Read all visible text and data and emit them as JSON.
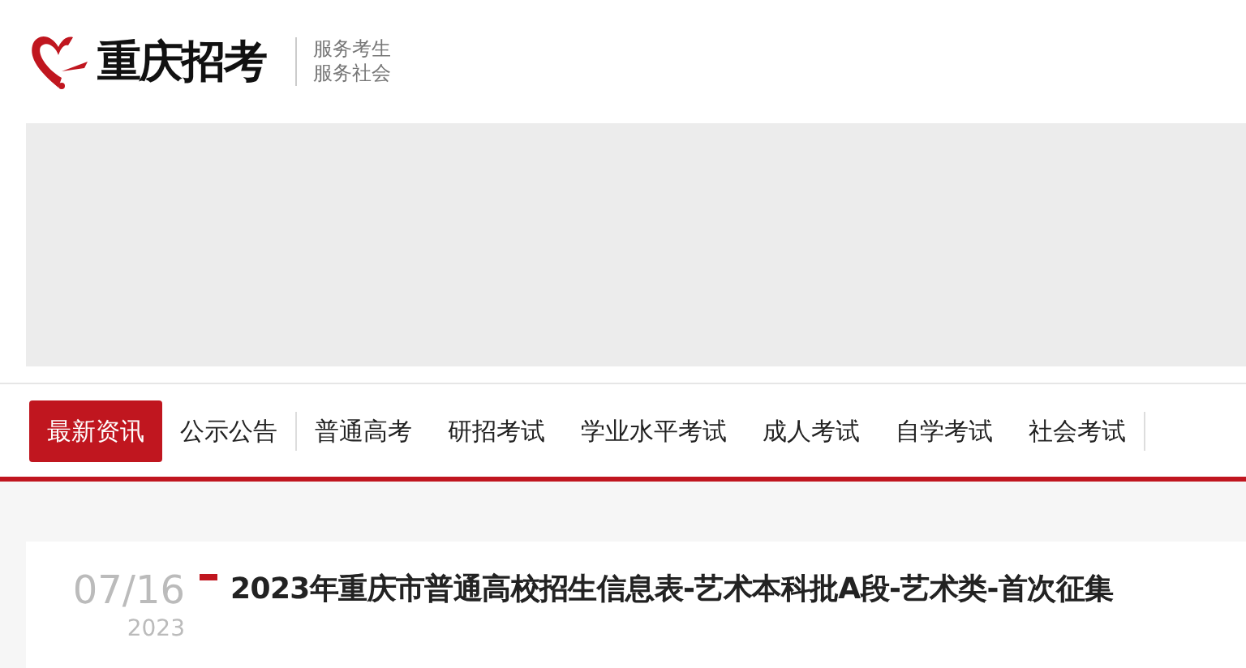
{
  "header": {
    "logo_text": "重庆招考",
    "slogans": [
      "服务考生",
      "服务社会"
    ]
  },
  "banner": {
    "kind": "blank"
  },
  "nav": [
    {
      "label": "最新资讯",
      "selected": true
    },
    {
      "label": "公示公告",
      "selected": false
    },
    {
      "label": "普通高考",
      "selected": false
    },
    {
      "label": "研招考试",
      "selected": false
    },
    {
      "label": "学业水平考试",
      "selected": false
    },
    {
      "label": "成人考试",
      "selected": false
    },
    {
      "label": "自学考试",
      "selected": false
    },
    {
      "label": "社会考试",
      "selected": false
    }
  ],
  "articles": [
    {
      "date": "07/16",
      "year": "2023",
      "title": "2023年重庆市普通高校招生信息表-艺术本科批A段-艺术类-首次征集"
    }
  ]
}
